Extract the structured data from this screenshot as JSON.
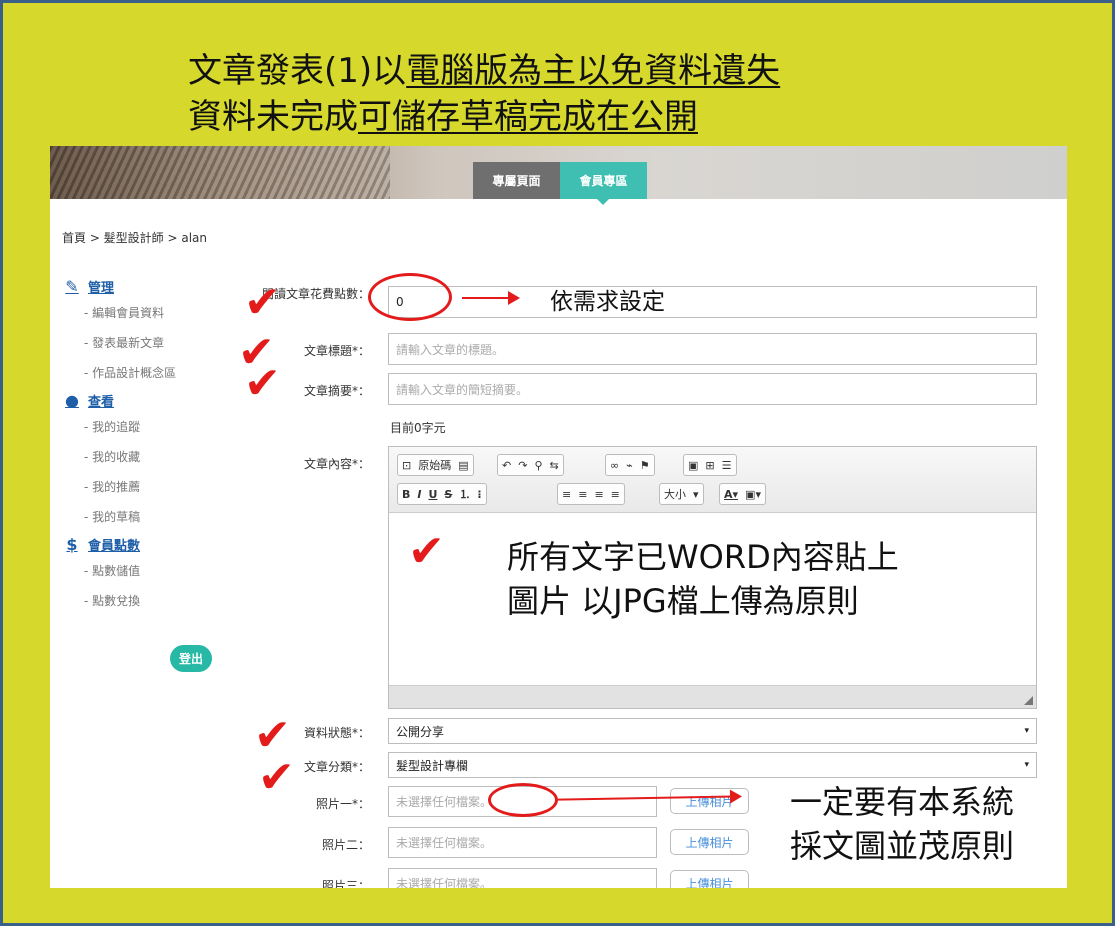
{
  "slide": {
    "title_line1_plain": "文章發表(1)以",
    "title_line1_underlined": "電腦版為主以免資料遺失",
    "title_line2_plain": "資料未完成",
    "title_line2_underlined": "可儲存草稿完成在公開"
  },
  "nav": {
    "tab1": "專屬頁面",
    "tab2": "會員專區"
  },
  "breadcrumb": "首頁 > 髮型設計師 > alan",
  "sidebar": {
    "group_manage": "管理",
    "manage_items": [
      "- 編輯會員資料",
      "- 發表最新文章",
      "- 作品設計概念區"
    ],
    "group_view": "查看",
    "view_items": [
      "- 我的追蹤",
      "- 我的收藏",
      "- 我的推薦",
      "- 我的草稿"
    ],
    "group_points": "會員點數",
    "points_items": [
      "- 點數儲值",
      "- 點數兌換"
    ],
    "logout": "登出"
  },
  "form": {
    "cost_label": "閱讀文章花費點數：",
    "cost_value": "0",
    "title_label": "文章標題*：",
    "title_placeholder": "請輸入文章的標題。",
    "summary_label": "文章摘要*：",
    "summary_placeholder": "請輸入文章的簡短摘要。",
    "char_count": "目前0字元",
    "content_label": "文章內容*：",
    "toolbar_source": "原始碼",
    "toolbar_size": "大小",
    "status_label": "資料狀態*：",
    "status_value": "公開分享",
    "category_label": "文章分類*：",
    "category_value": "髮型設計專欄",
    "photo1_label": "照片一*：",
    "photo2_label": "照片二：",
    "photo3_label": "照片三：",
    "file_placeholder": "未選擇任何檔案。",
    "upload_button": "上傳相片"
  },
  "annotations": {
    "cost_note": "依需求設定",
    "content_note_line1": "所有文字已WORD內容貼上",
    "content_note_line2": "圖片 以JPG檔上傳為原則",
    "photo_note_line1": "一定要有本系統",
    "photo_note_line2": "採文圖並茂原則"
  }
}
